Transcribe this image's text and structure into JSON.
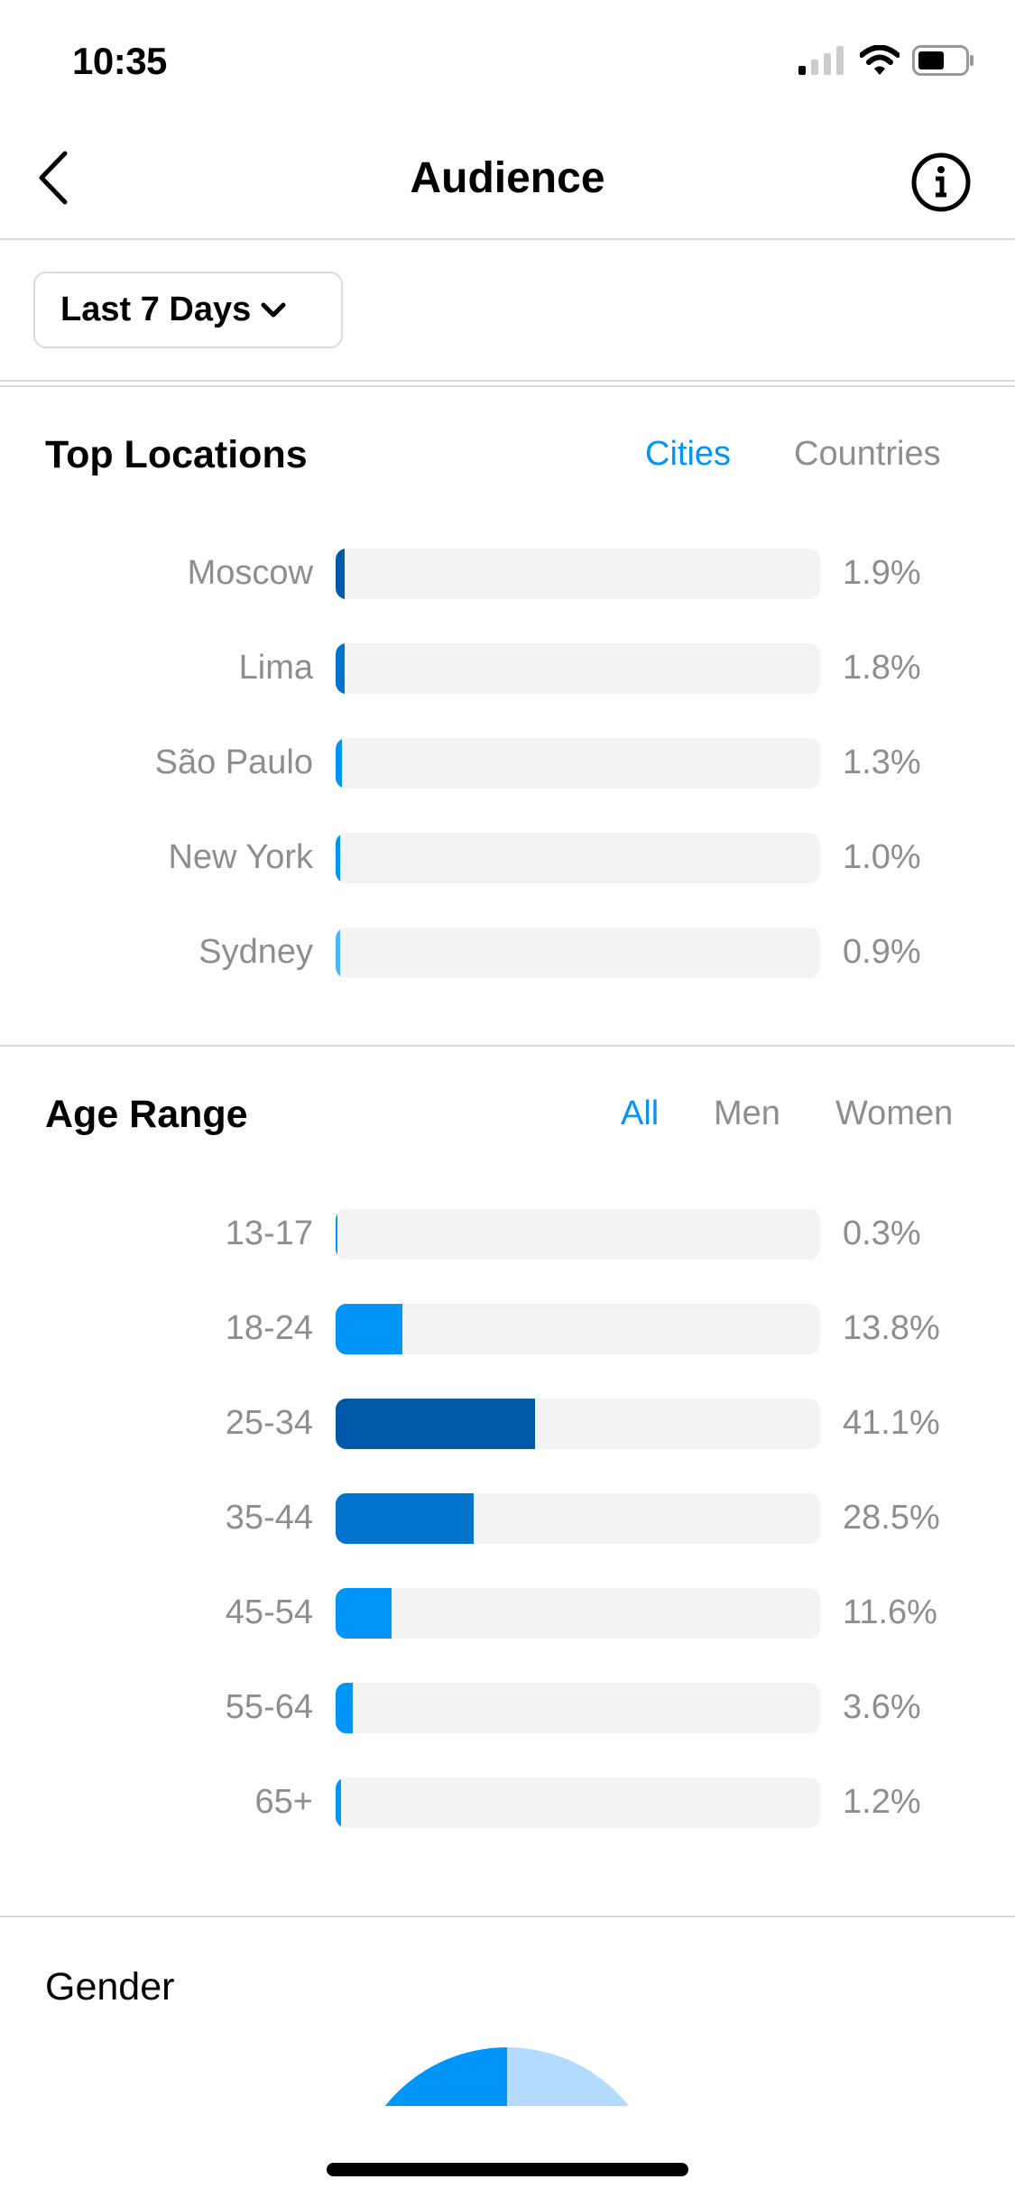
{
  "status_bar": {
    "time": "10:35",
    "icons": [
      "cellular-signal-icon",
      "wifi-icon",
      "battery-icon"
    ]
  },
  "nav": {
    "title": "Audience",
    "back_icon": "chevron-left-icon",
    "info_icon": "info-icon"
  },
  "date_range": {
    "label": "Last 7 Days",
    "icon": "chevron-down-icon"
  },
  "top_locations": {
    "title": "Top Locations",
    "tabs": [
      {
        "label": "Cities",
        "active": true
      },
      {
        "label": "Countries",
        "active": false
      }
    ],
    "rows": [
      {
        "label": "Moscow",
        "value": "1.9%",
        "percent": 1.9,
        "color": "#0058a8"
      },
      {
        "label": "Lima",
        "value": "1.8%",
        "percent": 1.8,
        "color": "#0074cc"
      },
      {
        "label": "São Paulo",
        "value": "1.3%",
        "percent": 1.3,
        "color": "#0095f6"
      },
      {
        "label": "New York",
        "value": "1.0%",
        "percent": 1.0,
        "color": "#0095f6"
      },
      {
        "label": "Sydney",
        "value": "0.9%",
        "percent": 0.9,
        "color": "#4db5f9"
      }
    ]
  },
  "age_range": {
    "title": "Age Range",
    "tabs": [
      {
        "label": "All",
        "active": true
      },
      {
        "label": "Men",
        "active": false
      },
      {
        "label": "Women",
        "active": false
      }
    ],
    "rows": [
      {
        "label": "13-17",
        "value": "0.3%",
        "percent": 0.3,
        "color": "#0095f6"
      },
      {
        "label": "18-24",
        "value": "13.8%",
        "percent": 13.8,
        "color": "#0095f6"
      },
      {
        "label": "25-34",
        "value": "41.1%",
        "percent": 41.1,
        "color": "#0058a8"
      },
      {
        "label": "35-44",
        "value": "28.5%",
        "percent": 28.5,
        "color": "#0074cc"
      },
      {
        "label": "45-54",
        "value": "11.6%",
        "percent": 11.6,
        "color": "#0095f6"
      },
      {
        "label": "55-64",
        "value": "3.6%",
        "percent": 3.6,
        "color": "#0095f6"
      },
      {
        "label": "65+",
        "value": "1.2%",
        "percent": 1.2,
        "color": "#0095f6"
      }
    ]
  },
  "gender": {
    "title": "Gender",
    "colors": {
      "primary": "#0095f6",
      "secondary": "#b3dbfd"
    }
  },
  "colors": {
    "accent": "#0095f6",
    "track": "#f3f3f3",
    "muted_text": "#8e8e8e"
  }
}
